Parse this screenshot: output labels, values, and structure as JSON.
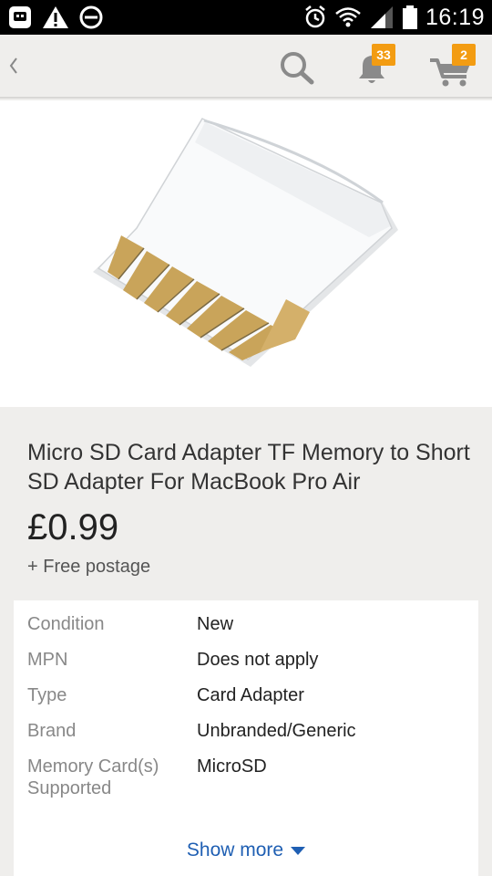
{
  "status_bar": {
    "time": "16:19",
    "icons": [
      "app-icon",
      "warning-icon",
      "do-not-disturb-icon",
      "alarm-icon",
      "wifi-icon",
      "signal-icon",
      "battery-icon"
    ]
  },
  "action_bar": {
    "icons": [
      "back-chevron-icon",
      "search-icon",
      "bell-icon",
      "cart-icon"
    ],
    "notifications_count": "33",
    "cart_count": "2",
    "badge_color": "#f39c12"
  },
  "product": {
    "title": "Micro SD Card Adapter TF Memory to Short SD Adapter For MacBook Pro Air",
    "price": "£0.99",
    "postage": "+ Free postage"
  },
  "specs": {
    "rows": [
      {
        "label": "Condition",
        "value": "New"
      },
      {
        "label": "MPN",
        "value": "Does not apply"
      },
      {
        "label": "Type",
        "value": "Card Adapter"
      },
      {
        "label": "Brand",
        "value": "Unbranded/Generic"
      },
      {
        "label": "Memory Card(s) Supported",
        "value": "MicroSD"
      }
    ],
    "show_more": "Show more",
    "link_color": "#1f5fb3"
  }
}
